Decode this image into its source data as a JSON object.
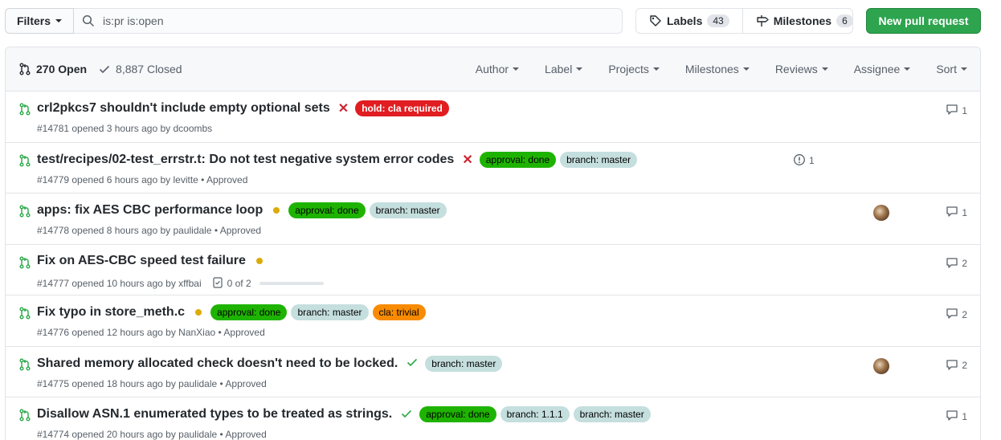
{
  "topbar": {
    "filters_label": "Filters",
    "search_value": "is:pr is:open",
    "labels_label": "Labels",
    "labels_count": "43",
    "milestones_label": "Milestones",
    "milestones_count": "6",
    "new_pr_label": "New pull request"
  },
  "header": {
    "open_label": "270 Open",
    "closed_label": "8,887 Closed",
    "filters": [
      "Author",
      "Label",
      "Projects",
      "Milestones",
      "Reviews",
      "Assignee",
      "Sort"
    ]
  },
  "colors": {
    "accent_green": "#2ea44f",
    "pr_open_green": "#28a745",
    "fail_red": "#cb2431",
    "pending_yellow": "#dbab09"
  },
  "prs": [
    {
      "title": "crl2pkcs7 shouldn't include empty optional sets",
      "status": "failure",
      "labels": [
        {
          "text": "hold: cla required",
          "kind": "red"
        }
      ],
      "meta": "#14781 opened 3 hours ago by dcoombs",
      "comments": "1"
    },
    {
      "title": "test/recipes/02-test_errstr.t: Do not test negative system error codes",
      "status": "failure",
      "labels": [
        {
          "text": "approval: done",
          "kind": "green"
        },
        {
          "text": "branch: master",
          "kind": "blue"
        }
      ],
      "meta": "#14779 opened 6 hours ago by levitte • Approved",
      "linked_issues": "1"
    },
    {
      "title": "apps: fix AES CBC performance loop",
      "status": "pending",
      "labels": [
        {
          "text": "approval: done",
          "kind": "green"
        },
        {
          "text": "branch: master",
          "kind": "blue"
        }
      ],
      "meta": "#14778 opened 8 hours ago by paulidale • Approved",
      "avatar": true,
      "comments": "1"
    },
    {
      "title": "Fix on AES-CBC speed test failure",
      "status": "pending",
      "labels": [],
      "meta": "#14777 opened 10 hours ago by xffbai",
      "tasks": "0 of 2",
      "tasks_done_fraction": 0,
      "comments": "2"
    },
    {
      "title": "Fix typo in store_meth.c",
      "status": "pending",
      "labels": [
        {
          "text": "approval: done",
          "kind": "green"
        },
        {
          "text": "branch: master",
          "kind": "blue"
        },
        {
          "text": "cla: trivial",
          "kind": "orange"
        }
      ],
      "meta": "#14776 opened 12 hours ago by NanXiao • Approved",
      "comments": "2"
    },
    {
      "title": "Shared memory allocated check doesn't need to be locked.",
      "status": "success",
      "labels": [
        {
          "text": "branch: master",
          "kind": "blue"
        }
      ],
      "meta": "#14775 opened 18 hours ago by paulidale • Approved",
      "avatar": true,
      "comments": "2"
    },
    {
      "title": "Disallow ASN.1 enumerated types to be treated as strings.",
      "status": "success",
      "labels": [
        {
          "text": "approval: done",
          "kind": "green"
        },
        {
          "text": "branch: 1.1.1",
          "kind": "blue"
        },
        {
          "text": "branch: master",
          "kind": "blue"
        }
      ],
      "meta": "#14774 opened 20 hours ago by paulidale • Approved",
      "comments": "1"
    }
  ]
}
